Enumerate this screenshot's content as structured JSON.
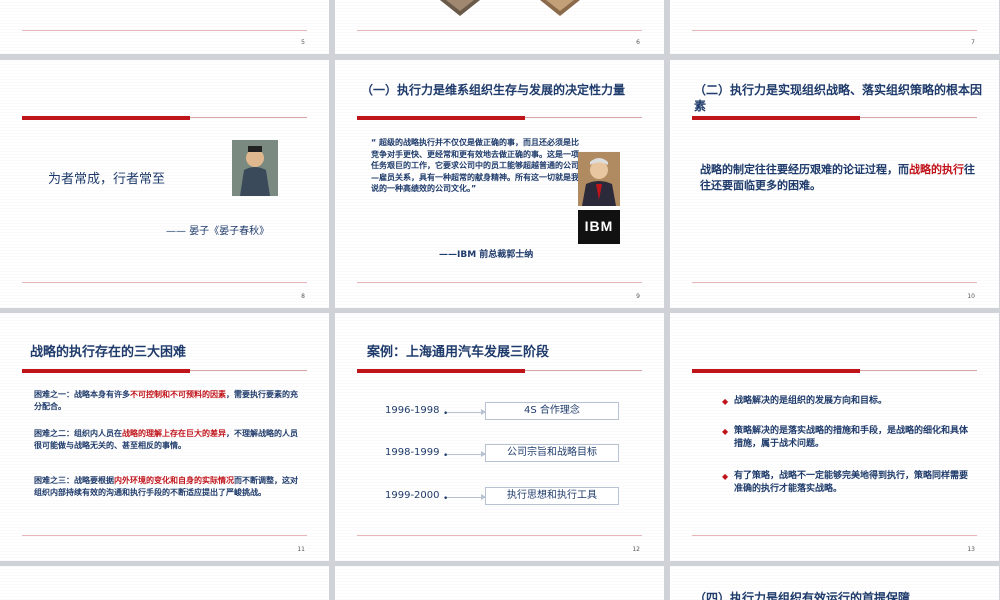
{
  "slides": {
    "s5": {
      "page": "5"
    },
    "s6": {
      "page": "6"
    },
    "s7": {
      "page": "7"
    },
    "s8": {
      "page": "8",
      "quote": "为者常成，行者常至",
      "attribution": "—— 晏子《晏子春秋》"
    },
    "s9": {
      "page": "9",
      "title": "（一）执行力是维系组织生存与发展的决定性力量",
      "quote": "“ 超级的战略执行并不仅仅是做正确的事，而且还必须是比竞争对手更快、更经常和更有效地去做正确的事。这是一项任务艰巨的工作，它要求公司中的员工能够超越普通的公司—雇员关系，具有一种超常的献身精神。所有这一切就是我说的一种高绩效的公司文化。”",
      "attribution": "——IBM 前总裁郭士纳",
      "logo_text": "IBM"
    },
    "s10": {
      "page": "10",
      "title": "（二）执行力是实现组织战略、落实组织策略的根本因素",
      "body_a": "战略的制定往往要经历艰难的论证过程，而",
      "body_red": "战略的执行",
      "body_b": "往往还要面临更多的困难。"
    },
    "s11": {
      "page": "11",
      "title": "战略的执行存在的三大困难",
      "p1a": "困难之一：战略本身有许多",
      "p1r": "不可控制和不可预料的因素",
      "p1b": "，需要执行要素的充分配合。",
      "p2a": "困难之二：组织内人员在",
      "p2r": "战略的理解上存在巨大的差异",
      "p2b": "，不理解战略的人员很可能做与战略无关的、甚至相反的事情。",
      "p3a": "困难之三：战略要根据",
      "p3r": "内外环境的变化和自身的实际情况",
      "p3b": "而不断调整，这对组织内部持续有效的沟通和执行手段的不断适应提出了严峻挑战。"
    },
    "s12": {
      "page": "12",
      "title": "案例：上海通用汽车发展三阶段",
      "rows": [
        {
          "year": "1996-1998",
          "box": "4S 合作理念"
        },
        {
          "year": "1998-1999",
          "box": "公司宗旨和战略目标"
        },
        {
          "year": "1999-2000",
          "box": "执行思想和执行工具"
        }
      ]
    },
    "s13": {
      "page": "13",
      "bullets": [
        "战略解决的是组织的发展方向和目标。",
        "策略解决的是落实战略的措施和手段，是战略的细化和具体措施，属于战术问题。",
        "有了策略，战略不一定能够完美地得到执行，策略同样需要准确的执行才能落实战略。"
      ]
    },
    "s16": {
      "title": "（四）执行力是组织有效运行的首提保障"
    }
  },
  "colors": {
    "accent": "#c0141b",
    "text": "#1f3b6b",
    "background": "#cfd3d8"
  }
}
